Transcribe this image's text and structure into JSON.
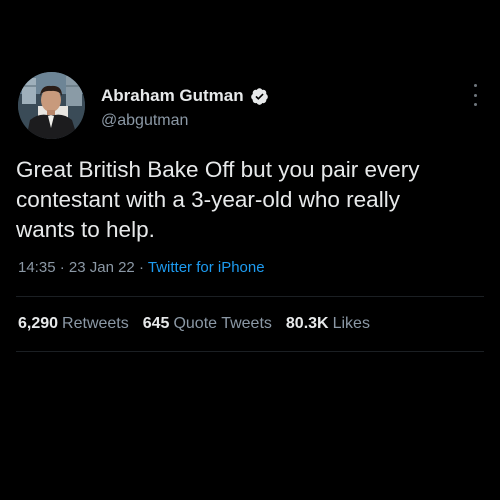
{
  "tweet": {
    "author": {
      "display_name": "Abraham Gutman",
      "handle": "@abgutman",
      "verified": true
    },
    "text_lines": [
      "Great British Bake Off but you pair every",
      "contestant with a 3-year-old who really",
      "wants to help."
    ],
    "time": "14:35",
    "date": "23 Jan 22",
    "separator": "·",
    "source": "Twitter for iPhone",
    "stats": {
      "retweets_count": "6,290",
      "retweets_label": "Retweets",
      "quotes_count": "645",
      "quotes_label": "Quote Tweets",
      "likes_count": "80.3K",
      "likes_label": "Likes"
    }
  },
  "colors": {
    "background": "#000000",
    "primary_text": "#e7e9ea",
    "secondary_text": "#8b98a5",
    "link": "#1d9bf0",
    "verified_badge": "#e7e9ea"
  },
  "icons": {
    "verified": "verified-badge-icon",
    "more": "more-options-icon"
  }
}
